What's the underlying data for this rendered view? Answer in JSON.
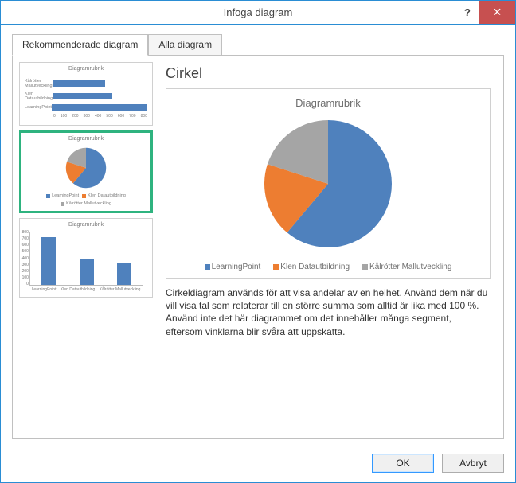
{
  "window": {
    "title": "Infoga diagram",
    "help_tooltip": "?",
    "close_tooltip": "✕"
  },
  "tabs": {
    "recommended": "Rekommenderade diagram",
    "all": "Alla diagram"
  },
  "thumbs": {
    "thumb_title": "Diagramrubrik",
    "hbar": {
      "rows": [
        "Kålrötter Mallutveckling",
        "Klen Datautbildning",
        "LearningPoint"
      ],
      "ticks": [
        "0",
        "100",
        "200",
        "300",
        "400",
        "500",
        "600",
        "700",
        "800"
      ]
    },
    "pie": {
      "legend": [
        "LearningPoint",
        "Klen Datautbildning",
        "Kålrötter Mallutveckling"
      ]
    },
    "vbar": {
      "yticks": [
        "800",
        "700",
        "600",
        "500",
        "400",
        "300",
        "200",
        "100",
        "0"
      ],
      "xlabels": [
        "LearningPoint",
        "Klen Datautbildning",
        "Kålrötter Mallutveckling"
      ]
    }
  },
  "preview": {
    "heading": "Cirkel",
    "chart_title": "Diagramrubrik",
    "legend": [
      "LearningPoint",
      "Klen Datautbildning",
      "Kålrötter Mallutveckling"
    ],
    "description": "Cirkeldiagram används för att visa andelar av en helhet. Använd dem när du vill visa tal som relaterar till en större summa som alltid är lika med 100 %. Använd inte det här diagrammet om det innehåller många segment, eftersom vinklarna blir svåra att uppskatta."
  },
  "buttons": {
    "ok": "OK",
    "cancel": "Avbryt"
  },
  "colors": {
    "blue": "#4f81bd",
    "orange": "#ed7d31",
    "gray": "#a5a5a5"
  },
  "chart_data": {
    "type": "pie",
    "title": "Diagramrubrik",
    "categories": [
      "LearningPoint",
      "Klen Datautbildning",
      "Kålrötter Mallutveckling"
    ],
    "values": [
      750,
      400,
      350
    ],
    "colors": [
      "#4f81bd",
      "#ed7d31",
      "#a5a5a5"
    ]
  }
}
